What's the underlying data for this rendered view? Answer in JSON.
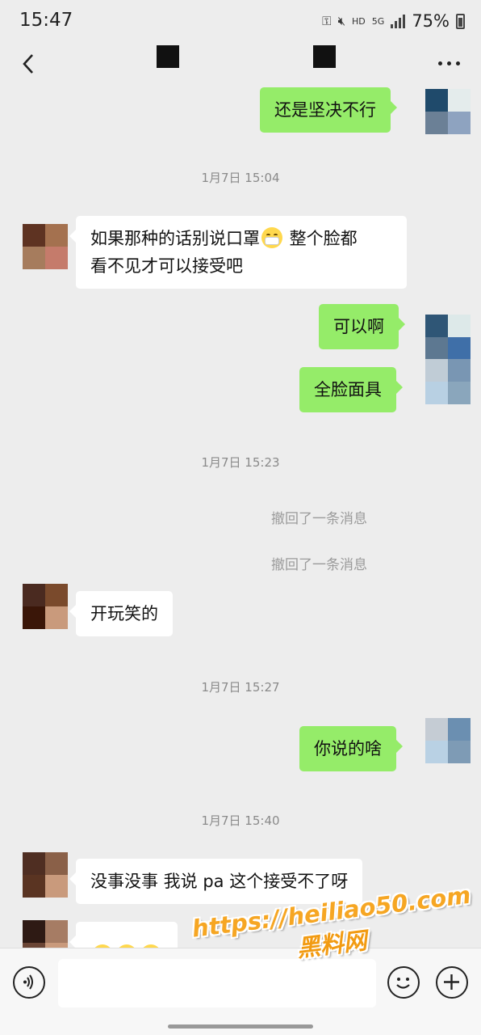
{
  "status_bar": {
    "time": "15:47",
    "network": "5G",
    "hd": "HD",
    "battery": "75%"
  },
  "colors": {
    "background": "#ededed",
    "outgoing_bubble": "#95ec69",
    "incoming_bubble": "#ffffff",
    "watermark": "#f6a623"
  },
  "nav": {
    "back_icon": "chevron-left-icon",
    "more_icon": "more-dots-icon"
  },
  "messages": {
    "m1": "还是坚决不行",
    "ts1": "1月7日 15:04",
    "m2_part1": "如果那种的话别说口罩",
    "m2_emoji": "mask-face-emoji",
    "m2_part2": " 整个脸都",
    "m2_line2": "看不见才可以接受吧",
    "m3": "可以啊",
    "m4": "全脸面具",
    "ts2": "1月7日 15:23",
    "sys1": "撤回了一条消息",
    "sys2": "撤回了一条消息",
    "m5": "开玩笑的",
    "ts3": "1月7日 15:27",
    "m6": "你说的啥",
    "ts4": "1月7日 15:40",
    "m7": "没事没事 我说 pa 这个接受不了呀",
    "m8_emoji": "eye-roll-emoji"
  },
  "input_bar": {
    "voice_icon": "voice-icon",
    "emoji_icon": "smiley-icon",
    "plus_icon": "plus-icon",
    "placeholder": ""
  },
  "watermark": {
    "url": "https://heiliao50.com",
    "cn": "黑料网"
  }
}
